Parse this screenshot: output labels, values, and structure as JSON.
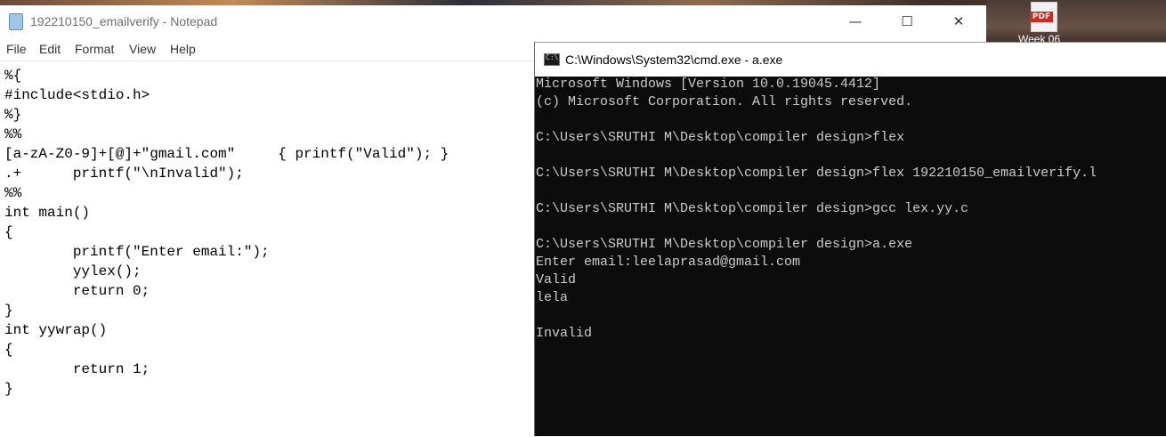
{
  "desktop": {
    "pdf_tag": "PDF",
    "icon_label": "Week 06"
  },
  "notepad": {
    "title": "192210150_emailverify - Notepad",
    "controls": {
      "minimize": "—",
      "maximize": "☐",
      "close": "✕"
    },
    "menu": [
      "File",
      "Edit",
      "Format",
      "View",
      "Help"
    ],
    "lines": [
      "%{",
      "#include<stdio.h>",
      "%}",
      "%%",
      "[a-zA-Z0-9]+[@]+\"gmail.com\"     { printf(\"Valid\"); }",
      ".+      printf(\"\\nInvalid\");",
      "%%",
      "int main()",
      "{",
      "        printf(\"Enter email:\");",
      "        yylex();",
      "        return 0;",
      "}",
      "int yywrap()",
      "{",
      "        return 1;",
      "}"
    ]
  },
  "cmd": {
    "icon_text": "C:\\",
    "title": "C:\\Windows\\System32\\cmd.exe - a.exe",
    "lines": [
      "Microsoft Windows [Version 10.0.19045.4412]",
      "(c) Microsoft Corporation. All rights reserved.",
      "",
      "C:\\Users\\SRUTHI M\\Desktop\\compiler design>flex",
      "",
      "C:\\Users\\SRUTHI M\\Desktop\\compiler design>flex 192210150_emailverify.l",
      "",
      "C:\\Users\\SRUTHI M\\Desktop\\compiler design>gcc lex.yy.c",
      "",
      "C:\\Users\\SRUTHI M\\Desktop\\compiler design>a.exe",
      "Enter email:leelaprasad@gmail.com",
      "Valid",
      "lela",
      "",
      "Invalid"
    ]
  }
}
